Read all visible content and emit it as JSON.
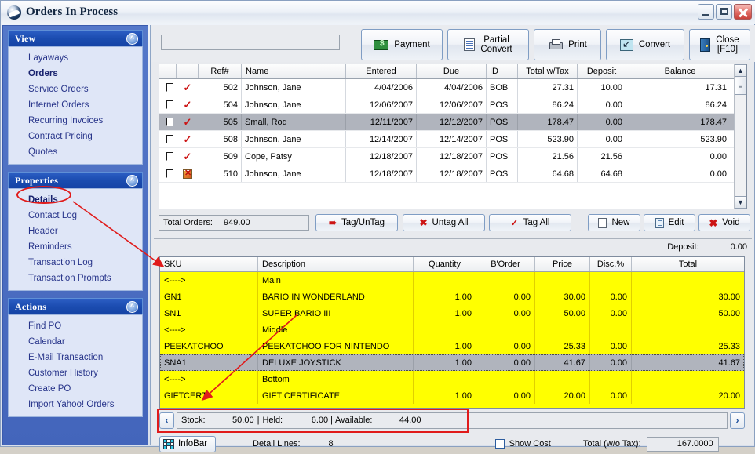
{
  "window": {
    "title": "Orders In Process",
    "icon": "app-logo-icon",
    "minimize_label": "",
    "maximize_label": "",
    "close_label": ""
  },
  "sidebar": {
    "panels": [
      {
        "title": "View",
        "collapse_icon": "chevron-up-icon",
        "items": [
          {
            "label": "Layaways",
            "active": false
          },
          {
            "label": "Orders",
            "active": true
          },
          {
            "label": "Service Orders",
            "active": false
          },
          {
            "label": "Internet Orders",
            "active": false
          },
          {
            "label": "Recurring Invoices",
            "active": false
          },
          {
            "label": "Contract Pricing",
            "active": false
          },
          {
            "label": "Quotes",
            "active": false
          }
        ]
      },
      {
        "title": "Properties",
        "collapse_icon": "chevron-up-icon",
        "items": [
          {
            "label": "Details",
            "active": true
          },
          {
            "label": "Contact Log",
            "active": false
          },
          {
            "label": "Header",
            "active": false
          },
          {
            "label": "Reminders",
            "active": false
          },
          {
            "label": "Transaction Log",
            "active": false
          },
          {
            "label": "Transaction Prompts",
            "active": false
          }
        ]
      },
      {
        "title": "Actions",
        "collapse_icon": "chevron-up-icon",
        "items": [
          {
            "label": "Find PO",
            "active": false
          },
          {
            "label": "Calendar",
            "active": false
          },
          {
            "label": "E-Mail Transaction",
            "active": false
          },
          {
            "label": "Customer History",
            "active": false
          },
          {
            "label": "Create PO",
            "active": false
          },
          {
            "label": "Import Yahoo! Orders",
            "active": false
          }
        ]
      }
    ]
  },
  "toolbar": {
    "filter_value": "",
    "filter_placeholder": "",
    "buttons": [
      {
        "label": "Payment",
        "icon": "money-icon"
      },
      {
        "label": "Partial\nConvert",
        "icon": "document-icon"
      },
      {
        "label": "Print",
        "icon": "printer-icon"
      },
      {
        "label": "Convert",
        "icon": "convert-icon"
      },
      {
        "label": "Close\n[F10]",
        "icon": "door-exit-icon"
      }
    ]
  },
  "orders_grid": {
    "columns": [
      "",
      "",
      "Ref#",
      "Name",
      "Entered",
      "Due",
      "ID",
      "Total w/Tax",
      "Deposit",
      "Balance"
    ],
    "rows": [
      {
        "tagged": false,
        "status": "check",
        "ref": "502",
        "name": "Johnson, Jane",
        "entered": "4/04/2006",
        "due": "4/04/2006",
        "id": "BOB",
        "total": "27.31",
        "deposit": "10.00",
        "balance": "17.31",
        "selected": false
      },
      {
        "tagged": false,
        "status": "check",
        "ref": "504",
        "name": "Johnson, Jane",
        "entered": "12/06/2007",
        "due": "12/06/2007",
        "id": "POS",
        "total": "86.24",
        "deposit": "0.00",
        "balance": "86.24",
        "selected": false
      },
      {
        "tagged": false,
        "status": "check",
        "ref": "505",
        "name": "Small, Rod",
        "entered": "12/11/2007",
        "due": "12/12/2007",
        "id": "POS",
        "total": "178.47",
        "deposit": "0.00",
        "balance": "178.47",
        "selected": true
      },
      {
        "tagged": false,
        "status": "check",
        "ref": "508",
        "name": "Johnson, Jane",
        "entered": "12/14/2007",
        "due": "12/14/2007",
        "id": "POS",
        "total": "523.90",
        "deposit": "0.00",
        "balance": "523.90",
        "selected": false
      },
      {
        "tagged": false,
        "status": "check",
        "ref": "509",
        "name": "Cope, Patsy",
        "entered": "12/18/2007",
        "due": "12/18/2007",
        "id": "POS",
        "total": "21.56",
        "deposit": "21.56",
        "balance": "0.00",
        "selected": false
      },
      {
        "tagged": false,
        "status": "broken-image",
        "ref": "510",
        "name": "Johnson, Jane",
        "entered": "12/18/2007",
        "due": "12/18/2007",
        "id": "POS",
        "total": "64.68",
        "deposit": "64.68",
        "balance": "0.00",
        "selected": false
      }
    ],
    "scroll_up_icon": "chevron-up-icon",
    "scroll_down_icon": "chevron-down-icon"
  },
  "midbar": {
    "total_orders_label": "Total Orders:",
    "total_orders_value": "949.00",
    "buttons": [
      {
        "label": "Tag/UnTag",
        "icon": "tag-arrow-icon"
      },
      {
        "label": "Untag All",
        "icon": "untag-all-icon"
      },
      {
        "label": "Tag All",
        "icon": "tag-all-icon"
      },
      {
        "label": "New",
        "icon": "new-document-icon"
      },
      {
        "label": "Edit",
        "icon": "edit-document-icon"
      },
      {
        "label": "Void",
        "icon": "void-x-icon"
      }
    ]
  },
  "detail": {
    "deposit_label": "Deposit:",
    "deposit_value": "0.00",
    "columns": [
      "SKU",
      "Description",
      "Quantity",
      "B'Order",
      "Price",
      "Disc.%",
      "Total"
    ],
    "rows": [
      {
        "sku": "<---->",
        "description": "Main",
        "quantity": "",
        "border": "",
        "price": "",
        "disc": "",
        "total": "",
        "selected": false
      },
      {
        "sku": "GN1",
        "description": "BARIO IN WONDERLAND",
        "quantity": "1.00",
        "border": "0.00",
        "price": "30.00",
        "disc": "0.00",
        "total": "30.00",
        "selected": false
      },
      {
        "sku": "SN1",
        "description": "SUPER BARIO III",
        "quantity": "1.00",
        "border": "0.00",
        "price": "50.00",
        "disc": "0.00",
        "total": "50.00",
        "selected": false
      },
      {
        "sku": "<---->",
        "description": "Middle",
        "quantity": "",
        "border": "",
        "price": "",
        "disc": "",
        "total": "",
        "selected": false
      },
      {
        "sku": "PEEKATCHOO",
        "description": "PEEKATCHOO FOR NINTENDO",
        "quantity": "1.00",
        "border": "0.00",
        "price": "25.33",
        "disc": "0.00",
        "total": "25.33",
        "selected": false
      },
      {
        "sku": "SNA1",
        "description": "DELUXE JOYSTICK",
        "quantity": "1.00",
        "border": "0.00",
        "price": "41.67",
        "disc": "0.00",
        "total": "41.67",
        "selected": true
      },
      {
        "sku": "<---->",
        "description": "Bottom",
        "quantity": "",
        "border": "",
        "price": "",
        "disc": "",
        "total": "",
        "selected": false
      },
      {
        "sku": "GIFTCERT",
        "description": "GIFT CERTIFICATE",
        "quantity": "1.00",
        "border": "0.00",
        "price": "20.00",
        "disc": "0.00",
        "total": "20.00",
        "selected": false
      }
    ]
  },
  "stockbar": {
    "prev_icon": "chevron-left-icon",
    "next_icon": "chevron-right-icon",
    "stock_label": "Stock:",
    "stock_value": "50.00",
    "sep1": "|",
    "held_label": "Held:",
    "held_value": "6.00",
    "sep2": "|",
    "available_label": "Available:",
    "available_value": "44.00"
  },
  "bottombar": {
    "infobar_label": "InfoBar",
    "infobar_icon": "grid-icon",
    "detail_lines_label": "Detail Lines:",
    "detail_lines_value": "8",
    "show_cost_label": "Show Cost",
    "show_cost_checked": false,
    "total_wo_tax_label": "Total (w/o Tax):",
    "total_wo_tax_value": "167.0000"
  },
  "annotations": {
    "highlight_color": "#e01b1b",
    "ellipse_target": "Details",
    "box_target": "Stock / Held / Available status field"
  }
}
